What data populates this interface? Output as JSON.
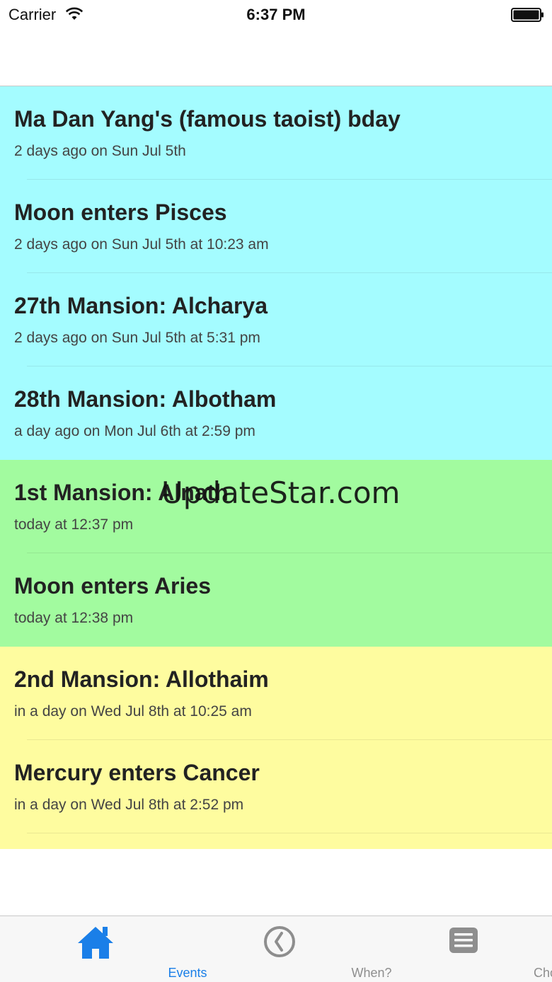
{
  "status_bar": {
    "carrier": "Carrier",
    "time": "6:37 PM"
  },
  "events": [
    {
      "title": "Ma Dan Yang's (famous taoist) bday",
      "time": "2 days ago on Sun Jul 5th",
      "group": "past"
    },
    {
      "title": "Moon enters Pisces",
      "time": "2 days ago on Sun Jul 5th at 10:23 am",
      "group": "past"
    },
    {
      "title": "27th Mansion: Alcharya",
      "time": "2 days ago on Sun Jul 5th at 5:31 pm",
      "group": "past"
    },
    {
      "title": "28th Mansion: Albotham",
      "time": "a day ago on Mon Jul 6th at 2:59 pm",
      "group": "past"
    },
    {
      "title": "1st Mansion: Alnath",
      "time": "today at 12:37 pm",
      "group": "today"
    },
    {
      "title": "Moon enters Aries",
      "time": "today at 12:38 pm",
      "group": "today"
    },
    {
      "title": "2nd Mansion: Allothaim",
      "time": "in a day on Wed Jul 8th at 10:25 am",
      "group": "future"
    },
    {
      "title": "Mercury enters Cancer",
      "time": "in a day on Wed Jul 8th at 2:52 pm",
      "group": "future"
    }
  ],
  "group_colors": {
    "past": "#a4fcff",
    "today": "#a2fb9f",
    "future": "#fefc9f"
  },
  "watermark": "UpdateStar.com",
  "tab_bar": {
    "tabs": [
      {
        "label": "Events",
        "icon": "home-icon",
        "active": true
      },
      {
        "label": "When?",
        "icon": "clock-icon",
        "active": false
      },
      {
        "label": "Choose",
        "icon": "list-icon",
        "active": false
      }
    ],
    "active_color": "#1a7fe8",
    "inactive_color": "#8e8e8e"
  }
}
